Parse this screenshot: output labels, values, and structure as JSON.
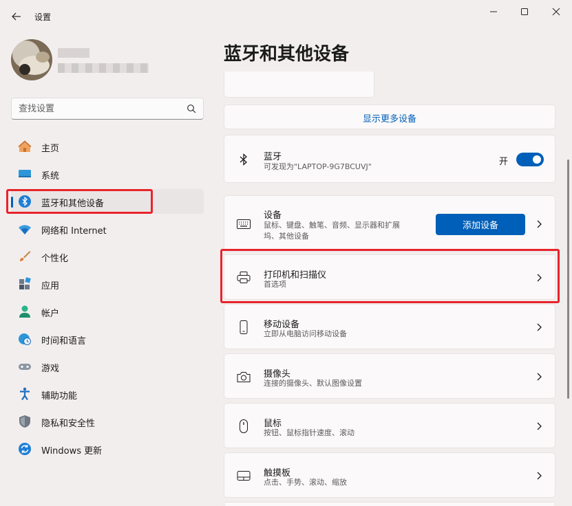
{
  "window": {
    "title": "设置"
  },
  "search": {
    "placeholder": "查找设置"
  },
  "sidebar": {
    "items": [
      {
        "label": "主页"
      },
      {
        "label": "系统"
      },
      {
        "label": "蓝牙和其他设备"
      },
      {
        "label": "网络和 Internet"
      },
      {
        "label": "个性化"
      },
      {
        "label": "应用"
      },
      {
        "label": "帐户"
      },
      {
        "label": "时间和语言"
      },
      {
        "label": "游戏"
      },
      {
        "label": "辅助功能"
      },
      {
        "label": "隐私和安全性"
      },
      {
        "label": "Windows 更新"
      }
    ]
  },
  "main": {
    "title": "蓝牙和其他设备",
    "show_more": "显示更多设备",
    "bluetooth": {
      "title": "蓝牙",
      "subtitle": "可发现为\"LAPTOP-9G7BCUVJ\"",
      "state": "开"
    },
    "devices": {
      "title": "设备",
      "subtitle_line1": "鼠标、键盘、触笔、音频、显示器和扩展",
      "subtitle_line2": "坞、其他设备",
      "button": "添加设备"
    },
    "list": [
      {
        "title": "打印机和扫描仪",
        "subtitle": "首选项"
      },
      {
        "title": "移动设备",
        "subtitle": "立即从电脑访问移动设备"
      },
      {
        "title": "摄像头",
        "subtitle": "连接的摄像头、默认图像设置"
      },
      {
        "title": "鼠标",
        "subtitle": "按钮、鼠标指针速度、滚动"
      },
      {
        "title": "触摸板",
        "subtitle": "点击、手势、滚动、缩放"
      }
    ]
  },
  "colors": {
    "accent": "#005fb8",
    "highlight": "#e8232a"
  }
}
